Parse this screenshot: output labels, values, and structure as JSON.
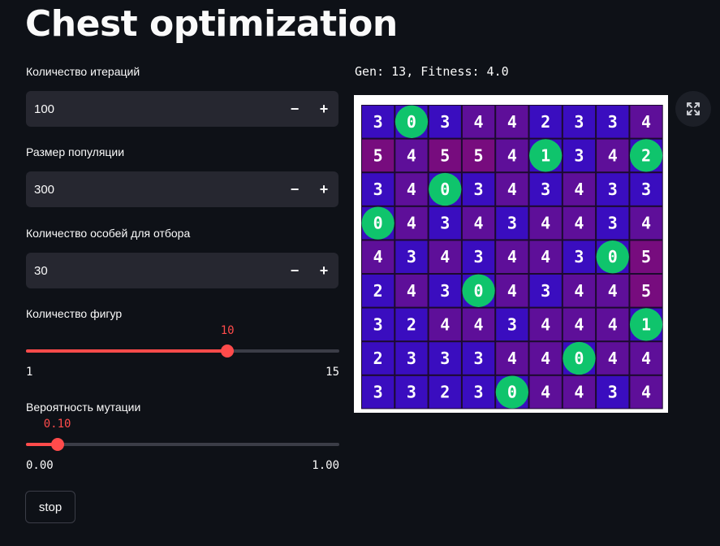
{
  "page": {
    "title": "Chest optimization"
  },
  "controls": {
    "iterations": {
      "label": "Количество итераций",
      "value": "100",
      "minus": "−",
      "plus": "+"
    },
    "population": {
      "label": "Размер популяции",
      "value": "300",
      "minus": "−",
      "plus": "+"
    },
    "selection": {
      "label": "Количество особей для отбора",
      "value": "30",
      "minus": "−",
      "plus": "+"
    },
    "figures": {
      "label": "Количество фигур",
      "value": "10",
      "min": "1",
      "max": "15",
      "fraction": 0.643
    },
    "mutation": {
      "label": "Вероятность мутации",
      "value": "0.10",
      "min": "0.00",
      "max": "1.00",
      "fraction": 0.1
    },
    "stop_label": "stop"
  },
  "result": {
    "status": "Gen: 13, Fitness: 4.0"
  },
  "board": {
    "col_labels": [
      "",
      "",
      "",
      "",
      "",
      "",
      "",
      "",
      ""
    ],
    "row_labels": [
      "",
      "",
      "",
      "",
      "",
      "",
      "",
      "",
      ""
    ],
    "cells": [
      [
        3,
        0,
        3,
        4,
        4,
        2,
        3,
        3,
        4
      ],
      [
        5,
        4,
        5,
        5,
        4,
        1,
        3,
        4,
        2
      ],
      [
        3,
        4,
        0,
        3,
        4,
        3,
        4,
        3,
        3
      ],
      [
        0,
        4,
        3,
        4,
        3,
        4,
        4,
        3,
        4
      ],
      [
        4,
        3,
        4,
        3,
        4,
        4,
        3,
        0,
        5
      ],
      [
        2,
        4,
        3,
        0,
        4,
        3,
        4,
        4,
        5
      ],
      [
        3,
        2,
        4,
        4,
        3,
        4,
        4,
        4,
        1
      ],
      [
        2,
        3,
        3,
        3,
        4,
        4,
        0,
        4,
        4
      ],
      [
        3,
        3,
        2,
        3,
        0,
        4,
        4,
        3,
        4
      ]
    ],
    "queens": [
      [
        0,
        1
      ],
      [
        1,
        5
      ],
      [
        1,
        8
      ],
      [
        2,
        2
      ],
      [
        3,
        0
      ],
      [
        4,
        7
      ],
      [
        5,
        3
      ],
      [
        6,
        8
      ],
      [
        7,
        6
      ],
      [
        8,
        4
      ]
    ],
    "colors": {
      "blue": "#3a0dbf",
      "purple": "#5e0f99",
      "magenta": "#770c7e",
      "queen": "#0fc46c",
      "grid": "#1c0a2e",
      "text": "#ffffff"
    }
  },
  "icons": {
    "expand": "expand-icon"
  }
}
